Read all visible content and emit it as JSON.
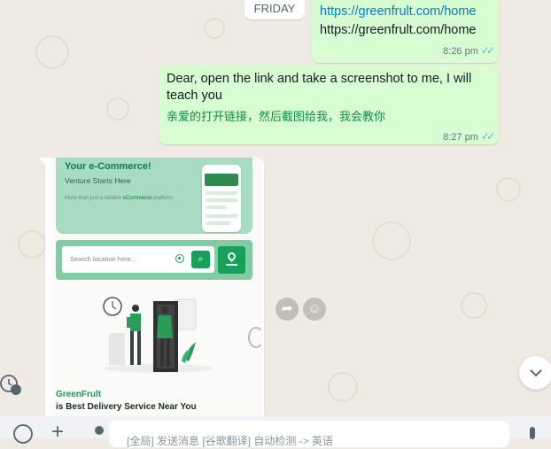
{
  "date_chip": "FRIDAY",
  "messages": {
    "msg1": {
      "link1": "https://greenfrult.com/home",
      "link2": "https://greenfrult.com/home",
      "time": "8:26 pm"
    },
    "msg2": {
      "text_en": "Dear, open the link and take a screenshot to me, I will teach you",
      "text_cn": "亲爱的打开链接，然后截图给我，我会教你",
      "time": "8:27 pm"
    }
  },
  "screenshot_card": {
    "hero_title": "Your e-Commerce!",
    "hero_subtitle": "Venture Starts Here",
    "hero_text_prefix": "More than just a reliable",
    "hero_text_highlight": "eCommerce",
    "hero_text_suffix": "platform",
    "search_placeholder": "Search location here...",
    "brand_name": "GreenFrult",
    "brand_tagline": "is Best Delivery Service Near You"
  },
  "composer": {
    "placeholder": "[全局] 发送消息 [谷歌翻译] 自动检测 -> 英语"
  },
  "icons": {
    "forward": "forward-icon",
    "emoji_react": "emoji-icon",
    "scroll_down": "chevron-down-icon",
    "emoji": "emoji-icon",
    "attach": "plus-icon",
    "mic": "mic-icon"
  }
}
